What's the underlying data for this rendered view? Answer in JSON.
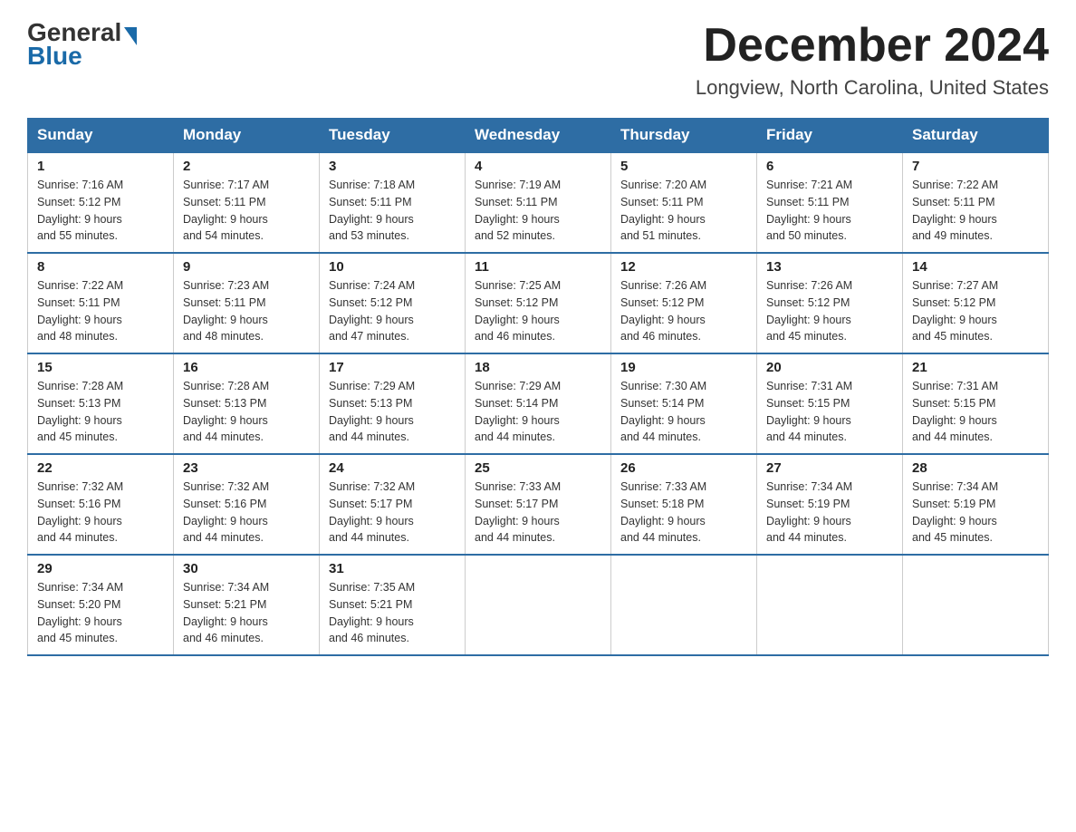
{
  "header": {
    "logo_general": "General",
    "logo_blue": "Blue",
    "month_title": "December 2024",
    "location": "Longview, North Carolina, United States"
  },
  "days_of_week": [
    "Sunday",
    "Monday",
    "Tuesday",
    "Wednesday",
    "Thursday",
    "Friday",
    "Saturday"
  ],
  "weeks": [
    [
      {
        "day": "1",
        "sunrise": "7:16 AM",
        "sunset": "5:12 PM",
        "daylight": "9 hours and 55 minutes."
      },
      {
        "day": "2",
        "sunrise": "7:17 AM",
        "sunset": "5:11 PM",
        "daylight": "9 hours and 54 minutes."
      },
      {
        "day": "3",
        "sunrise": "7:18 AM",
        "sunset": "5:11 PM",
        "daylight": "9 hours and 53 minutes."
      },
      {
        "day": "4",
        "sunrise": "7:19 AM",
        "sunset": "5:11 PM",
        "daylight": "9 hours and 52 minutes."
      },
      {
        "day": "5",
        "sunrise": "7:20 AM",
        "sunset": "5:11 PM",
        "daylight": "9 hours and 51 minutes."
      },
      {
        "day": "6",
        "sunrise": "7:21 AM",
        "sunset": "5:11 PM",
        "daylight": "9 hours and 50 minutes."
      },
      {
        "day": "7",
        "sunrise": "7:22 AM",
        "sunset": "5:11 PM",
        "daylight": "9 hours and 49 minutes."
      }
    ],
    [
      {
        "day": "8",
        "sunrise": "7:22 AM",
        "sunset": "5:11 PM",
        "daylight": "9 hours and 48 minutes."
      },
      {
        "day": "9",
        "sunrise": "7:23 AM",
        "sunset": "5:11 PM",
        "daylight": "9 hours and 48 minutes."
      },
      {
        "day": "10",
        "sunrise": "7:24 AM",
        "sunset": "5:12 PM",
        "daylight": "9 hours and 47 minutes."
      },
      {
        "day": "11",
        "sunrise": "7:25 AM",
        "sunset": "5:12 PM",
        "daylight": "9 hours and 46 minutes."
      },
      {
        "day": "12",
        "sunrise": "7:26 AM",
        "sunset": "5:12 PM",
        "daylight": "9 hours and 46 minutes."
      },
      {
        "day": "13",
        "sunrise": "7:26 AM",
        "sunset": "5:12 PM",
        "daylight": "9 hours and 45 minutes."
      },
      {
        "day": "14",
        "sunrise": "7:27 AM",
        "sunset": "5:12 PM",
        "daylight": "9 hours and 45 minutes."
      }
    ],
    [
      {
        "day": "15",
        "sunrise": "7:28 AM",
        "sunset": "5:13 PM",
        "daylight": "9 hours and 45 minutes."
      },
      {
        "day": "16",
        "sunrise": "7:28 AM",
        "sunset": "5:13 PM",
        "daylight": "9 hours and 44 minutes."
      },
      {
        "day": "17",
        "sunrise": "7:29 AM",
        "sunset": "5:13 PM",
        "daylight": "9 hours and 44 minutes."
      },
      {
        "day": "18",
        "sunrise": "7:29 AM",
        "sunset": "5:14 PM",
        "daylight": "9 hours and 44 minutes."
      },
      {
        "day": "19",
        "sunrise": "7:30 AM",
        "sunset": "5:14 PM",
        "daylight": "9 hours and 44 minutes."
      },
      {
        "day": "20",
        "sunrise": "7:31 AM",
        "sunset": "5:15 PM",
        "daylight": "9 hours and 44 minutes."
      },
      {
        "day": "21",
        "sunrise": "7:31 AM",
        "sunset": "5:15 PM",
        "daylight": "9 hours and 44 minutes."
      }
    ],
    [
      {
        "day": "22",
        "sunrise": "7:32 AM",
        "sunset": "5:16 PM",
        "daylight": "9 hours and 44 minutes."
      },
      {
        "day": "23",
        "sunrise": "7:32 AM",
        "sunset": "5:16 PM",
        "daylight": "9 hours and 44 minutes."
      },
      {
        "day": "24",
        "sunrise": "7:32 AM",
        "sunset": "5:17 PM",
        "daylight": "9 hours and 44 minutes."
      },
      {
        "day": "25",
        "sunrise": "7:33 AM",
        "sunset": "5:17 PM",
        "daylight": "9 hours and 44 minutes."
      },
      {
        "day": "26",
        "sunrise": "7:33 AM",
        "sunset": "5:18 PM",
        "daylight": "9 hours and 44 minutes."
      },
      {
        "day": "27",
        "sunrise": "7:34 AM",
        "sunset": "5:19 PM",
        "daylight": "9 hours and 44 minutes."
      },
      {
        "day": "28",
        "sunrise": "7:34 AM",
        "sunset": "5:19 PM",
        "daylight": "9 hours and 45 minutes."
      }
    ],
    [
      {
        "day": "29",
        "sunrise": "7:34 AM",
        "sunset": "5:20 PM",
        "daylight": "9 hours and 45 minutes."
      },
      {
        "day": "30",
        "sunrise": "7:34 AM",
        "sunset": "5:21 PM",
        "daylight": "9 hours and 46 minutes."
      },
      {
        "day": "31",
        "sunrise": "7:35 AM",
        "sunset": "5:21 PM",
        "daylight": "9 hours and 46 minutes."
      },
      null,
      null,
      null,
      null
    ]
  ],
  "labels": {
    "sunrise": "Sunrise:",
    "sunset": "Sunset:",
    "daylight": "Daylight:"
  }
}
